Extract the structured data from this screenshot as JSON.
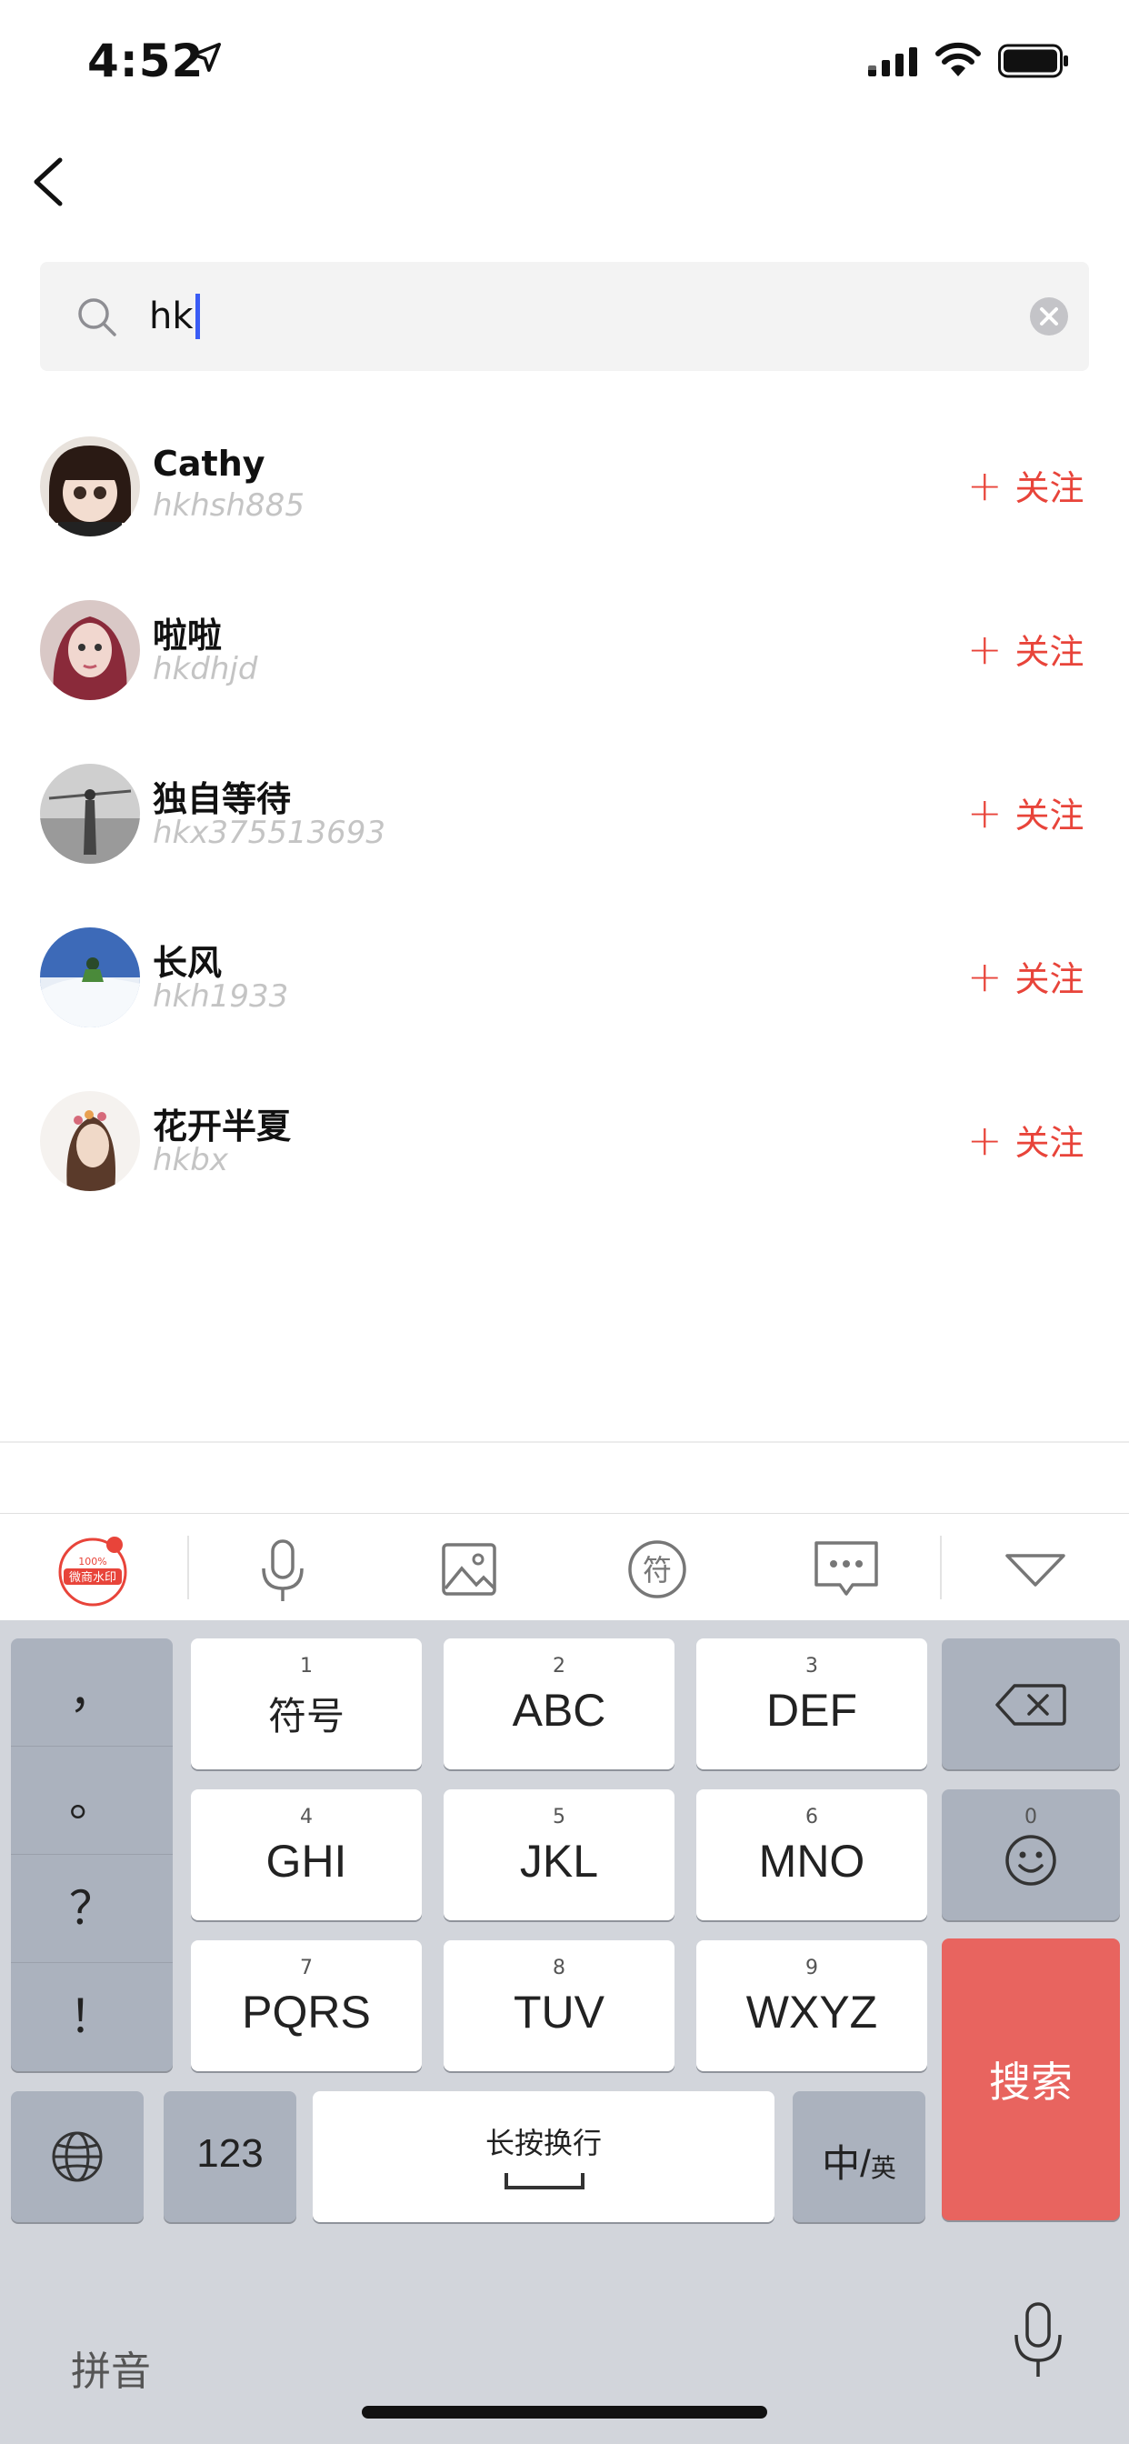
{
  "status_bar": {
    "time": "4:52"
  },
  "search": {
    "query": "hk"
  },
  "results": [
    {
      "name": "Cathy",
      "handle": "hkhsh885",
      "follow_label": "关注"
    },
    {
      "name": "啦啦",
      "handle": "hkdhjd",
      "follow_label": "关注"
    },
    {
      "name": "独自等待",
      "handle": "hkx375513693",
      "follow_label": "关注"
    },
    {
      "name": "长风",
      "handle": "hkh1933",
      "follow_label": "关注"
    },
    {
      "name": "花开半夏",
      "handle": "hkbx",
      "follow_label": "关注"
    }
  ],
  "keyboard": {
    "punctuation": [
      "，",
      "。",
      "？",
      "！"
    ],
    "keys": [
      {
        "num": "1",
        "label": "符号"
      },
      {
        "num": "2",
        "label": "ABC"
      },
      {
        "num": "3",
        "label": "DEF"
      },
      {
        "num": "4",
        "label": "GHI"
      },
      {
        "num": "5",
        "label": "JKL"
      },
      {
        "num": "6",
        "label": "MNO"
      },
      {
        "num": "7",
        "label": "PQRS"
      },
      {
        "num": "8",
        "label": "TUV"
      },
      {
        "num": "9",
        "label": "WXYZ"
      }
    ],
    "emoji_num": "0",
    "numbers_label": "123",
    "space_label": "长按换行",
    "lang_main": "中/",
    "lang_sub": "英",
    "search_label": "搜索",
    "pinyin_label": "拼音",
    "toolbar_symbol_glyph": "符",
    "toolbar_badge_line1": "100%",
    "toolbar_badge_line2": "微商水印"
  },
  "colors": {
    "accent": "#e8443a",
    "search_key": "#e8645f",
    "caret": "#3a5cf5"
  },
  "icons": [
    "location-arrow-icon",
    "signal-icon",
    "wifi-icon",
    "battery-icon",
    "back-chevron-icon",
    "search-icon",
    "clear-icon",
    "microphone-icon",
    "image-icon",
    "symbol-icon",
    "chat-icon",
    "collapse-keyboard-icon",
    "globe-icon",
    "backspace-icon",
    "emoji-icon"
  ]
}
